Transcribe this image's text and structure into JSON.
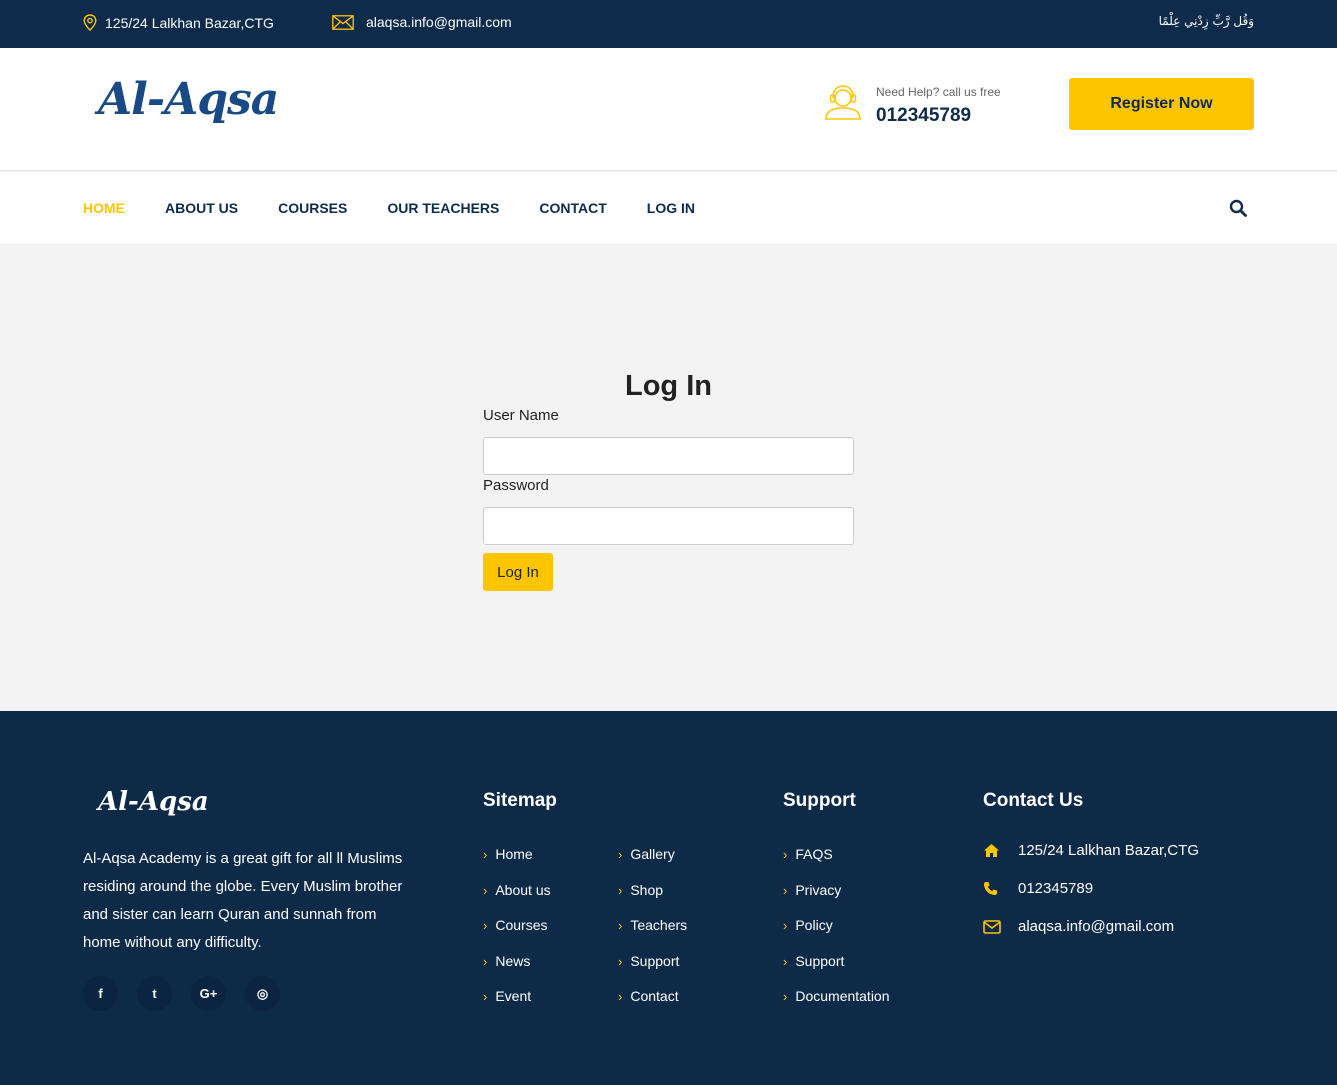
{
  "topbar": {
    "address": "125/24 Lalkhan Bazar,CTG",
    "email": "alaqsa.info@gmail.com",
    "arabic_text": "وَقُل رَّبِّ زِدْنِي عِلْمًا"
  },
  "header": {
    "logo": "Al-Aqsa",
    "help_label": "Need Help? call us free",
    "help_phone": "012345789",
    "register_label": "Register Now"
  },
  "nav": {
    "items": [
      {
        "label": "HOME"
      },
      {
        "label": "ABOUT US"
      },
      {
        "label": "COURSES"
      },
      {
        "label": "OUR TEACHERS"
      },
      {
        "label": "CONTACT"
      },
      {
        "label": "LOG IN"
      }
    ]
  },
  "login": {
    "title": "Log In",
    "username_label": "User Name",
    "username_value": "",
    "password_label": "Password",
    "password_value": "",
    "submit_label": "Log In"
  },
  "footer": {
    "logo": "Al-Aqsa",
    "about": "Al-Aqsa Academy is a great gift for all ll Muslims residing around the globe. Every Muslim brother and sister can learn Quran and sunnah from home without any difficulty.",
    "socials": [
      {
        "icon": "facebook-icon",
        "glyph": "f"
      },
      {
        "icon": "twitter-icon",
        "glyph": "t"
      },
      {
        "icon": "google-plus-icon",
        "glyph": "G+"
      },
      {
        "icon": "instagram-icon",
        "glyph": "◎"
      }
    ],
    "sitemap_title": "Sitemap",
    "sitemap_col1": [
      "Home",
      "About us",
      "Courses",
      "News",
      "Event"
    ],
    "sitemap_col2": [
      "Gallery",
      "Shop",
      "Teachers",
      "Support",
      "Contact"
    ],
    "support_title": "Support",
    "support_items": [
      "FAQS",
      "Privacy",
      "Policy",
      "Support",
      "Documentation"
    ],
    "contact_title": "Contact Us",
    "contact_address": "125/24 Lalkhan Bazar,CTG",
    "contact_phone": "012345789",
    "contact_email": "alaqsa.info@gmail.com"
  },
  "colors": {
    "navy": "#0f2b4b",
    "accent": "#fdc500",
    "footer_bg": "#0e2a49"
  }
}
